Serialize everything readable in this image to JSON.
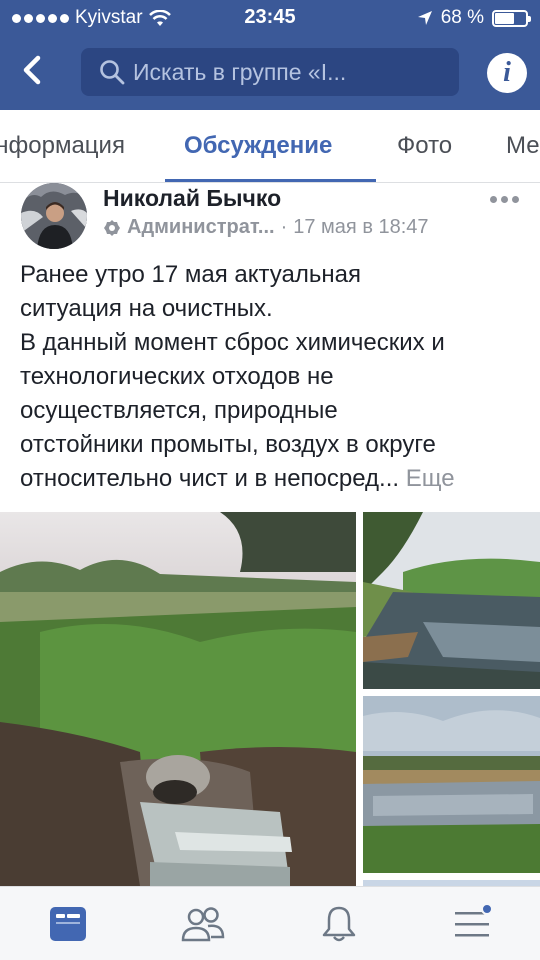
{
  "status_bar": {
    "carrier": "Kyivstar",
    "time": "23:45",
    "battery": "68 %",
    "battery_level": 0.68
  },
  "search": {
    "placeholder": "Искать в группе «I..."
  },
  "tabs": [
    {
      "label": "Информация"
    },
    {
      "label": "Обсуждение",
      "active": true
    },
    {
      "label": "Фото"
    },
    {
      "label": "Ме"
    }
  ],
  "post": {
    "author": "Николай Бычко",
    "role": "Администрат...",
    "separator": "·",
    "date": "17 мая в 18:47",
    "text_lines": [
      "Ранее утро 17 мая актуальная",
      "ситуация на очистных.",
      "В данный момент сброс химических и",
      "технологических отходов не",
      "осуществляется, природные",
      "отстойники промыты, воздух в округе",
      "относительно чист и в непосред..."
    ],
    "see_more": "Еще"
  },
  "colors": {
    "brand": "#3b5998",
    "accent": "#4267b2",
    "muted": "#90949c"
  },
  "bottom_nav": [
    {
      "icon": "news-feed-icon",
      "active": true
    },
    {
      "icon": "friends-icon"
    },
    {
      "icon": "notifications-bell-icon"
    },
    {
      "icon": "menu-icon",
      "badge": true
    }
  ]
}
